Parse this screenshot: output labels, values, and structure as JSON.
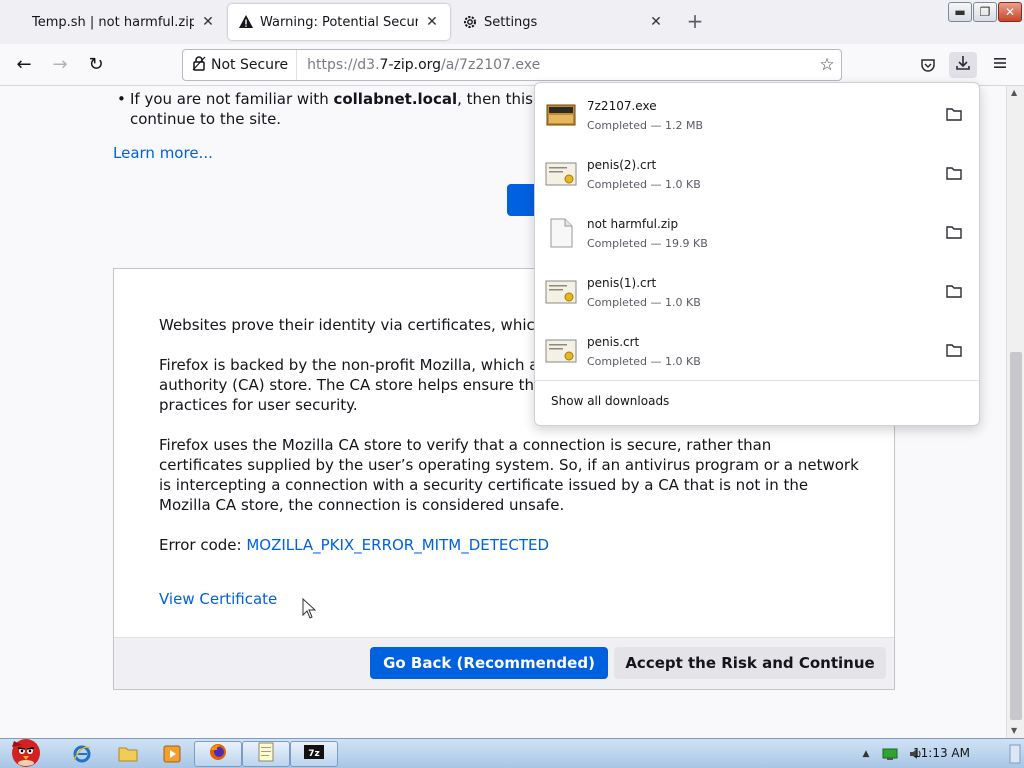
{
  "tabs": [
    {
      "title": "Temp.sh | not harmful.zip",
      "close": "✕"
    },
    {
      "title": "Warning: Potential Security Risk Ahead",
      "close": "✕",
      "icon": "warning-icon"
    },
    {
      "title": "Settings",
      "close": "✕",
      "icon": "gear-icon"
    }
  ],
  "new_tab": "+",
  "window_buttons": {
    "minimize": "▬",
    "restore": "❐",
    "close": "✕"
  },
  "nav": {
    "back": "←",
    "forward": "→",
    "reload": "↻",
    "security_label": "Not Secure",
    "url_prefix": "https://d3.",
    "url_domain": "7-zip.org",
    "url_path": "/a/7z2107.exe",
    "bookmark": "☆"
  },
  "page": {
    "bullet_prefix": "If you are not familiar with ",
    "bullet_bold": "collabnet.local",
    "bullet_suffix": ", then this could be an attack and you should not continue to the site.",
    "learn_more": "Learn more...",
    "para1": "Websites prove their identity via certificates, which are issued by certificate authorities.",
    "para2": "Firefox is backed by the non-profit Mozilla, which administers a completely open certificate authority (CA) store. The CA store helps ensure that certificate authorities are following best practices for user security.",
    "para3": "Firefox uses the Mozilla CA store to verify that a connection is secure, rather than certificates supplied by the user’s operating system. So, if an antivirus program or a network is intercepting a connection with a security certificate issued by a CA that is not in the Mozilla CA store, the connection is considered unsafe.",
    "error_label": "Error code: ",
    "error_code": "MOZILLA_PKIX_ERROR_MITM_DETECTED",
    "view_certificate": "View Certificate",
    "go_back": "Go Back (Recommended)",
    "accept_risk": "Accept the Risk and Continue"
  },
  "downloads": {
    "items": [
      {
        "name": "7z2107.exe",
        "status": "Completed — 1.2 MB",
        "icon": "exe-file-icon"
      },
      {
        "name": "penis(2).crt",
        "status": "Completed — 1.0 KB",
        "icon": "certificate-file-icon"
      },
      {
        "name": "not harmful.zip",
        "status": "Completed — 19.9 KB",
        "icon": "zip-file-icon"
      },
      {
        "name": "penis(1).crt",
        "status": "Completed — 1.0 KB",
        "icon": "certificate-file-icon"
      },
      {
        "name": "penis.crt",
        "status": "Completed — 1.0 KB",
        "icon": "certificate-file-icon"
      }
    ],
    "show_all": "Show all downloads"
  },
  "taskbar": {
    "clock": "11:13 AM"
  },
  "colors": {
    "accent": "#0061e0",
    "page_bg": "#f9f9fb",
    "panel_bg": "#ffffff"
  }
}
